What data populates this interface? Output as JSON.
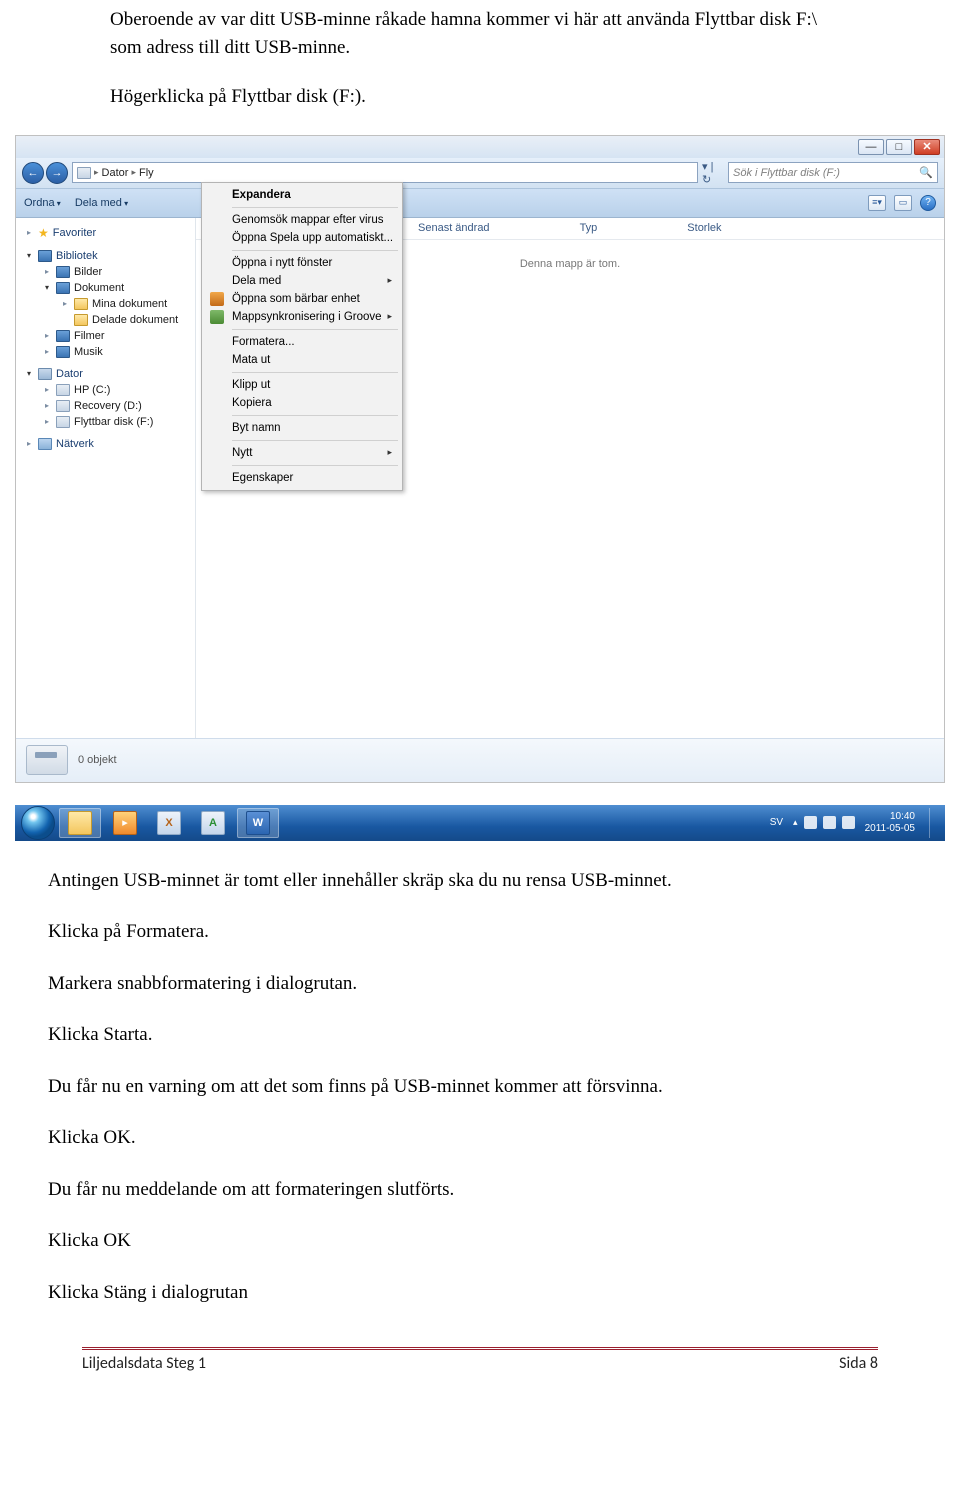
{
  "doc": {
    "intro1": "Oberoende av var ditt USB-minne råkade hamna kommer vi här att använda Flyttbar disk F:\\ som adress till ditt USB-minne.",
    "intro2": "Högerklicka på Flyttbar disk (F:).",
    "after1": "Antingen USB-minnet är tomt eller innehåller skräp ska du nu rensa USB-minnet.",
    "after2": "Klicka på Formatera.",
    "after3": "Markera snabbformatering i dialogrutan.",
    "after4": "Klicka Starta.",
    "after5": "Du får nu en varning om att det som finns på USB-minnet kommer att försvinna.",
    "after6": "Klicka OK.",
    "after7": "Du får nu meddelande om att formateringen slutförts.",
    "after8": "Klicka OK",
    "after9": "Klicka Stäng i dialogrutan"
  },
  "explorer": {
    "path": {
      "seg1": "Dator",
      "seg2": "Fly"
    },
    "search_placeholder": "Sök i Flyttbar disk (F:)",
    "toolbar": {
      "organize": "Ordna",
      "share": "Dela med"
    },
    "columns": {
      "modified": "Senast ändrad",
      "type": "Typ",
      "size": "Storlek"
    },
    "empty": "Denna mapp är tom.",
    "sidebar": {
      "favorites": "Favoriter",
      "libraries": "Bibliotek",
      "pictures": "Bilder",
      "documents": "Dokument",
      "mydocs": "Mina dokument",
      "shareddocs": "Delade dokument",
      "videos": "Filmer",
      "music": "Musik",
      "computer": "Dator",
      "drive_c": "HP (C:)",
      "drive_d": "Recovery (D:)",
      "drive_f": "Flyttbar disk (F:)",
      "network": "Nätverk"
    },
    "context": {
      "expand": "Expandera",
      "scan": "Genomsök mappar efter virus",
      "autoplay": "Öppna Spela upp automatiskt...",
      "newwin": "Öppna i nytt fönster",
      "sharewith": "Dela med",
      "portable": "Öppna som bärbar enhet",
      "groove": "Mappsynkronisering i Groove",
      "format": "Formatera...",
      "eject": "Mata ut",
      "cut": "Klipp ut",
      "copy": "Kopiera",
      "rename": "Byt namn",
      "new": "Nytt",
      "props": "Egenskaper"
    },
    "status": "0 objekt"
  },
  "taskbar": {
    "lang": "SV",
    "time": "10:40",
    "date": "2011-05-05"
  },
  "footer": {
    "left": "Liljedalsdata Steg 1",
    "right": "Sida 8"
  }
}
